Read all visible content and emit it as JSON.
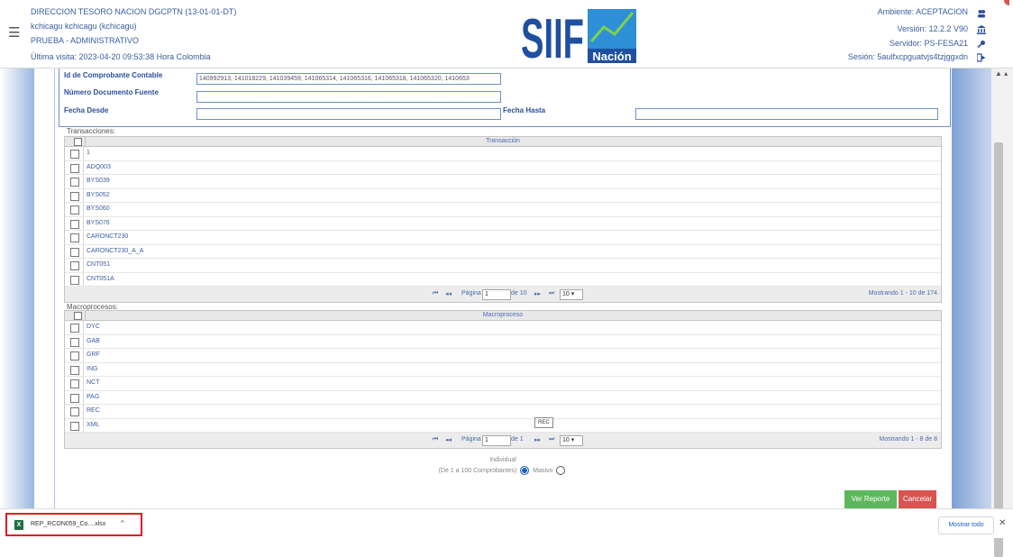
{
  "header": {
    "org": "DIRECCION TESORO NACION DGCPTN (13-01-01-DT)",
    "user": "kchicagu kchicagu (kchicagu)",
    "profile": "PRUEBA - ADMINISTRATIVO",
    "last_visit": "Última visita: 2023-04-20 09:53:38 Hora Colombia",
    "env": "Ambiente: ACEPTACION",
    "version": "Versión: 12.2.2 V90",
    "server": "Servidor: PS-FESA21",
    "session": "Sesión: 5aulfxcpguatvjs4tzjggxdn",
    "logo_text": "SIIF",
    "logo_sub": "Nación"
  },
  "filters": {
    "comprobante_label": "Id de Comprobante Contable",
    "comprobante_value": "140992913, 141018229, 141039459, 141065314, 141065316, 141065318, 141065320, 1410653",
    "documento_label": "Número Documento Fuente",
    "fecha_desde_label": "Fecha Desde",
    "fecha_hasta_label": "Fecha Hasta"
  },
  "transacciones": {
    "title": "Transacciones:",
    "column": "Transacción",
    "rows": [
      "1",
      "ADQ003",
      "BYS039",
      "BYS052",
      "BYS060",
      "BYS076",
      "CARONCT230",
      "CARONCT230_A_A",
      "CNT051",
      "CNT051A"
    ],
    "pager": {
      "page_label": "Página",
      "page": "1",
      "of": "de 10",
      "page_size": "10",
      "showing": "Mostrando 1 - 10 de 174"
    }
  },
  "macroprocesos": {
    "title": "Macroprocesos:",
    "column": "Macroproceso",
    "rows": [
      "DYC",
      "GAB",
      "GRF",
      "ING",
      "NCT",
      "PAG",
      "REC",
      "XML"
    ],
    "pager": {
      "page_label": "Página",
      "page": "1",
      "of": "de 1",
      "page_size": "10",
      "showing": "Mostrando 1 - 8 de 8"
    },
    "tooltip": "REC"
  },
  "options": {
    "title": "Individual",
    "line": "(De 1 a 100 Comprobantes)",
    "masivo": "Masivo",
    "selected": "individual"
  },
  "buttons": {
    "ver_reporte": "Ver Reporte",
    "cancelar": "Cancelar"
  },
  "downloads": {
    "file": "REP_RCON059_Co....xlsx",
    "show_all": "Mostrar todo",
    "close": "✕"
  },
  "colors": {
    "accent": "#2c4f9c",
    "green": "#5cb85c",
    "red": "#d9534f",
    "excel": "#1d6f42"
  }
}
